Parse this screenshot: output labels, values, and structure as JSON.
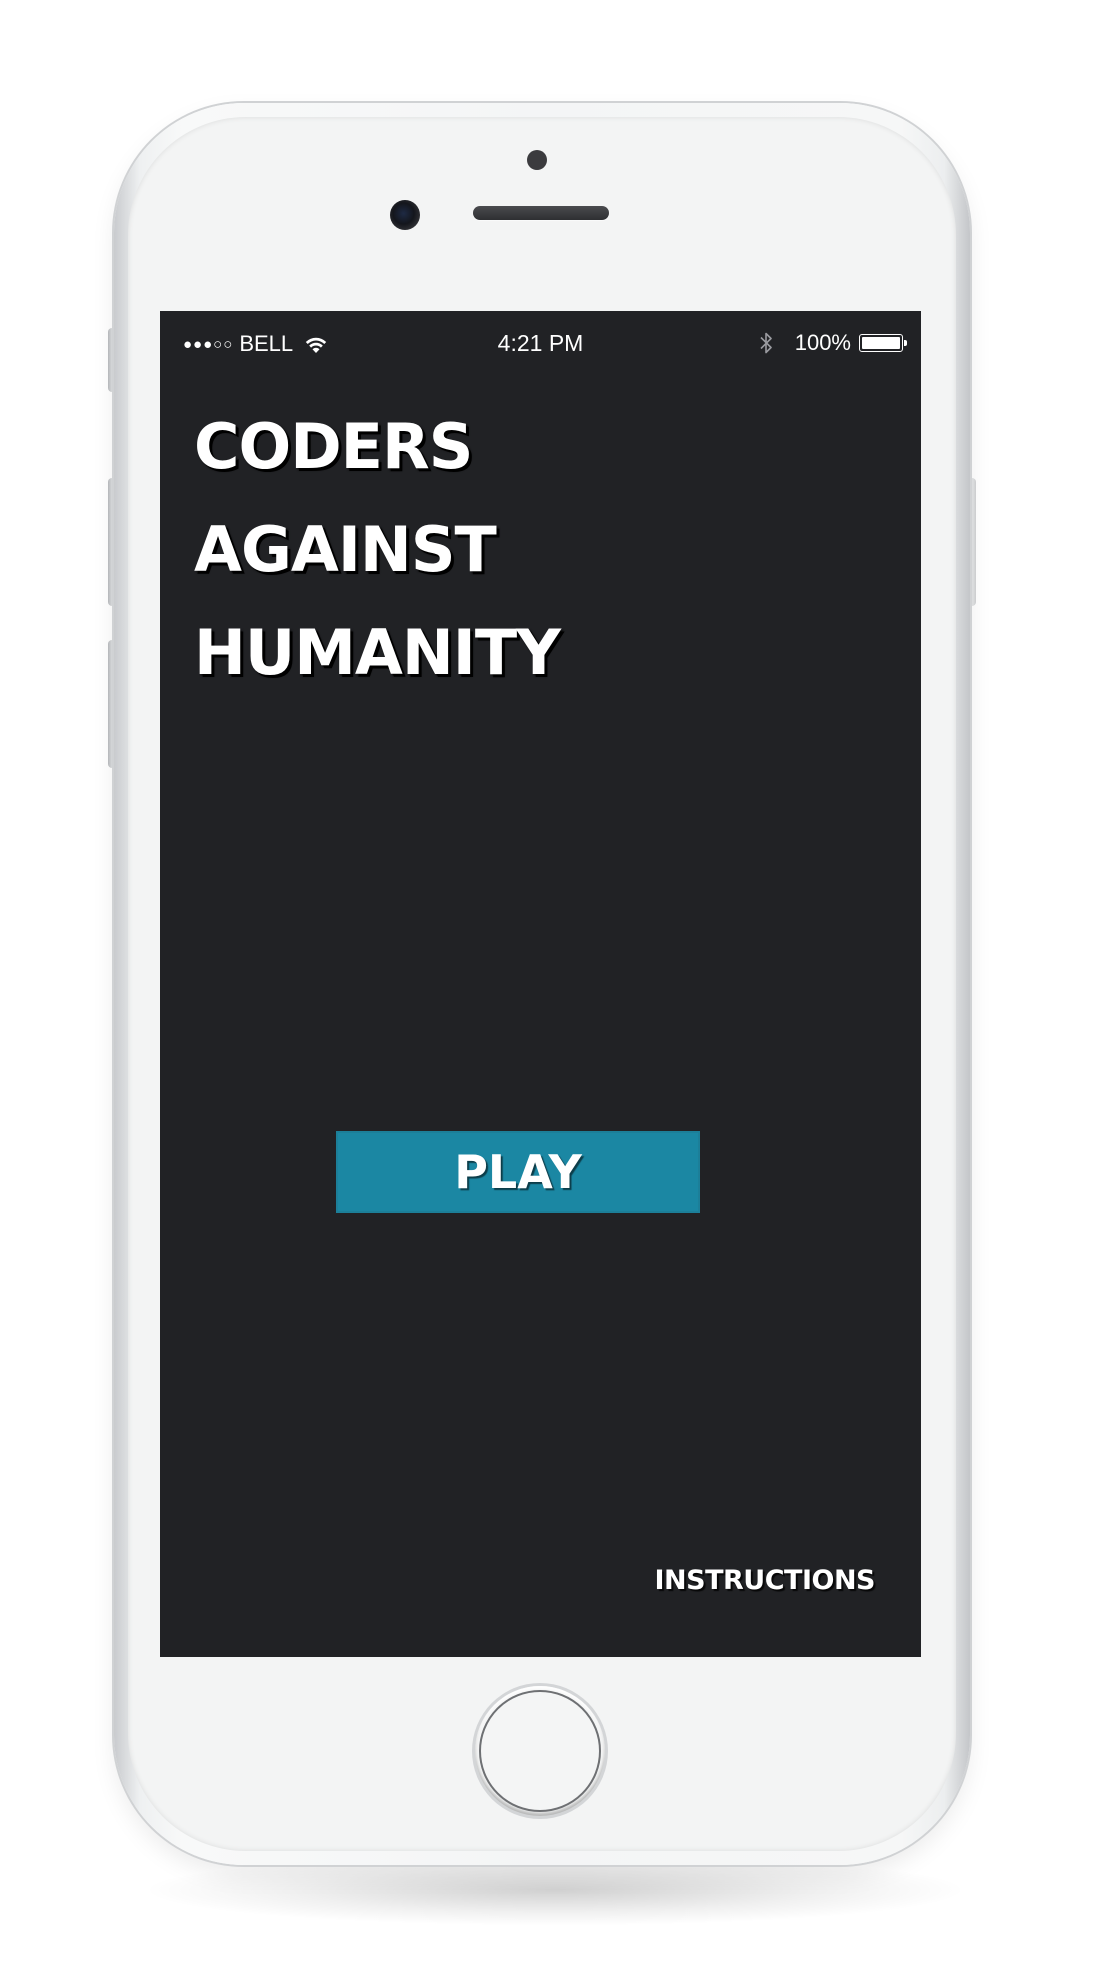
{
  "status_bar": {
    "signal": "●●●○○",
    "carrier": "BELL",
    "time": "4:21 PM",
    "battery": "100%",
    "battery_level": 1.0,
    "icons": [
      "wifi-icon",
      "bluetooth-icon",
      "battery-icon"
    ]
  },
  "title": {
    "line1": "CODERS",
    "line2": "AGAINST",
    "line3": "HUMANITY"
  },
  "buttons": {
    "play": "PLAY",
    "instructions": "INSTRUCTIONS"
  },
  "colors": {
    "screen_background": "#212225",
    "play_button": "#1b87a3",
    "text": "#ffffff"
  }
}
